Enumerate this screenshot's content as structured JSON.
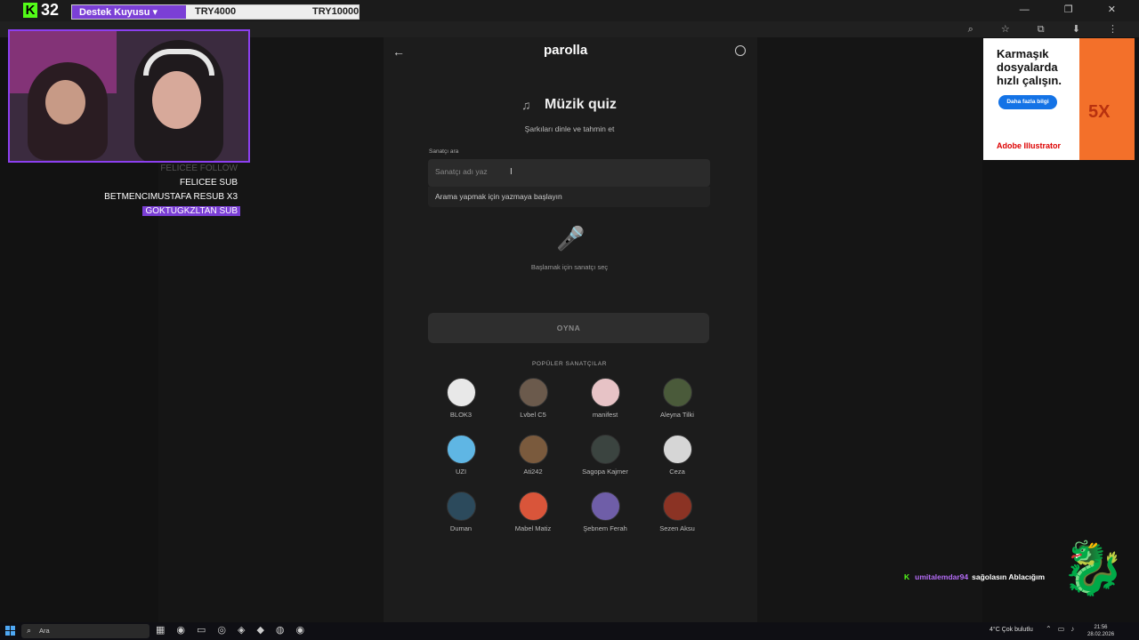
{
  "stream_overlay": {
    "viewer_count": "32",
    "goal_label": "Destek Kuyusu ▾",
    "goal_amount_1": "TRY4000",
    "goal_amount_2": "TRY10000",
    "alerts": [
      "FELICEE  FOLLOW",
      "FELICEE  SUB",
      "BETMENCIMUSTAFA  RESUB X3",
      "GOKTUGKZLTAN  SUB"
    ]
  },
  "app": {
    "logo": "parolla",
    "title": "Müzik quiz",
    "subtitle": "Şarkıları dinle ve tahmin et",
    "search": {
      "label": "Sanatçı ara",
      "placeholder": "Sanatçı adı yaz",
      "dropdown_hint": "Arama yapmak için yazmaya başlayın"
    },
    "start_hint": "Başlamak için sanatçı seç",
    "play_label": "OYNA",
    "popular_title": "POPÜLER SANATÇILAR",
    "artists": [
      {
        "name": "BLOK3",
        "color": "#e8e8e8"
      },
      {
        "name": "Lvbel C5",
        "color": "#6b5a4c"
      },
      {
        "name": "manifest",
        "color": "#e7c3c6"
      },
      {
        "name": "Aleyna Tilki",
        "color": "#4a5a3a"
      },
      {
        "name": "UZI",
        "color": "#5fb6e4"
      },
      {
        "name": "Ati242",
        "color": "#7a5a3d"
      },
      {
        "name": "Sagopa Kajmer",
        "color": "#3b4440"
      },
      {
        "name": "Ceza",
        "color": "#d6d6d6"
      },
      {
        "name": "Duman",
        "color": "#2c4a5c"
      },
      {
        "name": "Mabel Matiz",
        "color": "#d9553a"
      },
      {
        "name": "Şebnem Ferah",
        "color": "#6f5ea8"
      },
      {
        "name": "Sezen Aksu",
        "color": "#8b3324"
      }
    ]
  },
  "ad": {
    "headline": "Karmaşık dosyalarda hızlı çalışın.",
    "button": "Daha fazla bilgi",
    "brand": "Adobe Illustrator",
    "badge": "5X"
  },
  "chat": {
    "user": "umitalemdar94",
    "message": "sağolasın Ablacığım"
  },
  "taskbar": {
    "search_placeholder": "Ara",
    "weather": "4°C  Çok bulutlu",
    "time": "21:56",
    "date": "28.02.2026"
  }
}
